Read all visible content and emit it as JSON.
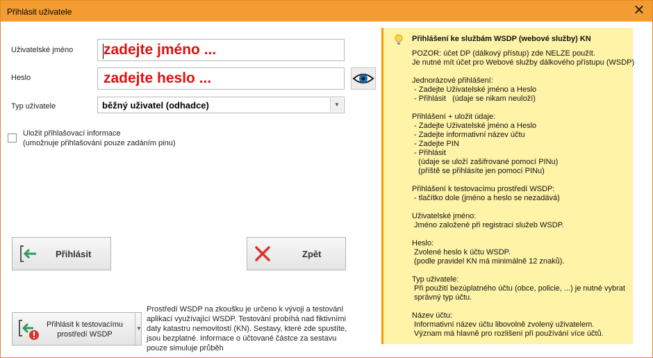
{
  "window": {
    "title": "Přihlásit uživatele",
    "close_glyph": "✕"
  },
  "form": {
    "username_label": "Uživatelské jméno",
    "username_placeholder": "zadejte jméno ...",
    "password_label": "Heslo",
    "password_placeholder": "zadejte heslo ...",
    "usertype_label": "Typ uživatele",
    "usertype_value": "běžný uživatel (odhadce)",
    "save_label_line1": "Uložit přihlašovací informace",
    "save_label_line2": "(umožnuje přihlašování pouze zadáním pinu)",
    "save_checked": false
  },
  "buttons": {
    "login": "Přihlásit",
    "back": "Zpět",
    "test_login": "Přihlásit k testovacímu prostředí WSDP"
  },
  "test_info": "Prostředí WSDP na zkoušku je určeno k vývoji a testování aplikací využívající WSDP. Testování probíhá nad fiktivními daty katastru nemovitostí (KN). Sestavy, které zde spustíte, jsou bezplatné. Informace o účtované částce za sestavu pouze simuluje průběh",
  "help": {
    "title": "Přihlášení ke službám WSDP (webové služby) KN",
    "text": "POZOR: účet DP (dálkový přístup) zde NELZE použít.\nJe nutné mít účet pro Webové služby dálkového přístupu (WSDP)\n\nJednorázové přihlášení:\n - Zadejte Uživatelské jméno a Heslo\n - Přihlásit   (údaje se nikam neuloží)\n\nPřihlášení + uložit údaje:\n - Zadejte Uživatelské jméno a Heslo\n - Zadejte informativní název účtu\n - Zadejte PIN\n - Přihlásit\n   (údaje se uloží zašifrované pomocí PINu)\n   (příště se přihlásíte jen pomocí PINu)\n\nPřihlášení k testovacímu prostředí WSDP:\n - tlačítko dole (jméno a heslo se nezadává)\n\nUživatelské jméno:\n Jméno založené při registraci služeb WSDP.\n\nHeslo:\n Zvolené heslo k účtu WSDP.\n (podle pravidel KN má minimálně 12 znaků).\n\nTyp uživatele:\n Při použití bezúplatného účtu (obce, policie, ...) je nutné vybrat\n správný typ účtu.\n\nNázev účtu:\n Informativní název účtu libovolně zvolený uživatelem.\n Význam má hlavně pro rozlišení při používání více účtů."
  },
  "icons": {
    "eye": "eye-icon",
    "login": "login-arrow-icon",
    "back": "cross-icon",
    "test": "login-warning-icon",
    "bulb": "lightbulb-icon"
  },
  "colors": {
    "titlebar": "#f39c32",
    "placeholder": "#e01010",
    "panel_bg": "#fff3a8",
    "panel_accent": "#ff9900",
    "arrow_green": "#2e9a5a",
    "cross_red": "#d9342b"
  }
}
